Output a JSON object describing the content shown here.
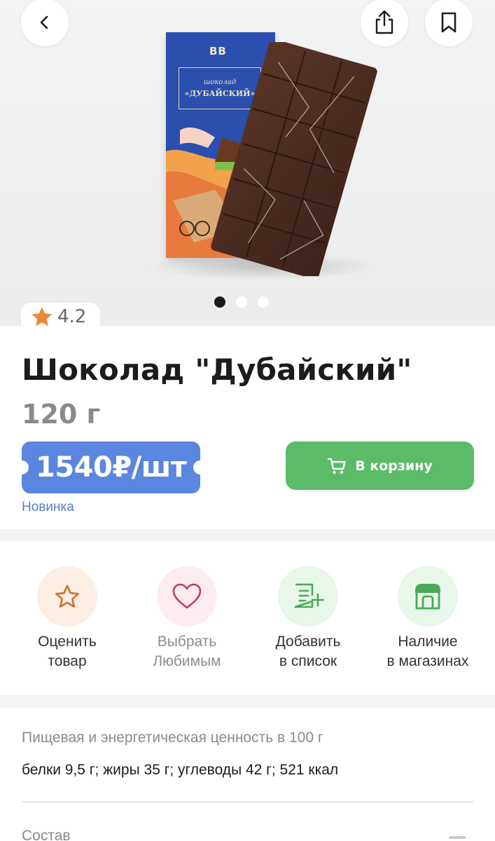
{
  "hero": {
    "pack_logo": "BB",
    "pack_line1": "шоколад",
    "pack_line2": "«ДУБАЙСКИЙ»",
    "pagination": {
      "count": 3,
      "active": 1
    }
  },
  "icons": {
    "back": "chevron-left-icon",
    "share": "share-icon",
    "bookmark": "bookmark-icon",
    "rating": "star-icon",
    "cart": "cart-icon"
  },
  "product": {
    "rating": "4.2",
    "title": "Шоколад \"Дубайский\"",
    "weight": "120 г",
    "price": "1540₽/шт",
    "cart_button": "В корзину",
    "badge": "Новинка"
  },
  "actions": [
    {
      "line1": "Оценить",
      "line2": "товар",
      "icon": "star-outline-icon",
      "bg": "#fdeee3",
      "color": "#c9742e"
    },
    {
      "line1": "Выбрать",
      "line2": "Любимым",
      "icon": "heart-outline-icon",
      "bg": "#fdecef",
      "color": "#c03d5c"
    },
    {
      "line1": "Добавить",
      "line2": "в список",
      "icon": "list-add-icon",
      "bg": "#e9f6ea",
      "color": "#4aa956"
    },
    {
      "line1": "Наличие",
      "line2": "в магазинах",
      "icon": "store-icon",
      "bg": "#e9f6ea",
      "color": "#4aa956"
    }
  ],
  "nutrition": {
    "title": "Пищевая и энергетическая ценность в 100 г",
    "value": "белки 9,5 г; жиры 35 г; углеводы 42 г; 521 ккал"
  },
  "composition": {
    "title": "Состав"
  },
  "colors": {
    "price_badge": "#5b86df",
    "cart_button": "#5bbb68",
    "new_label": "#5a80c8",
    "rating_star": "#e9893a"
  }
}
